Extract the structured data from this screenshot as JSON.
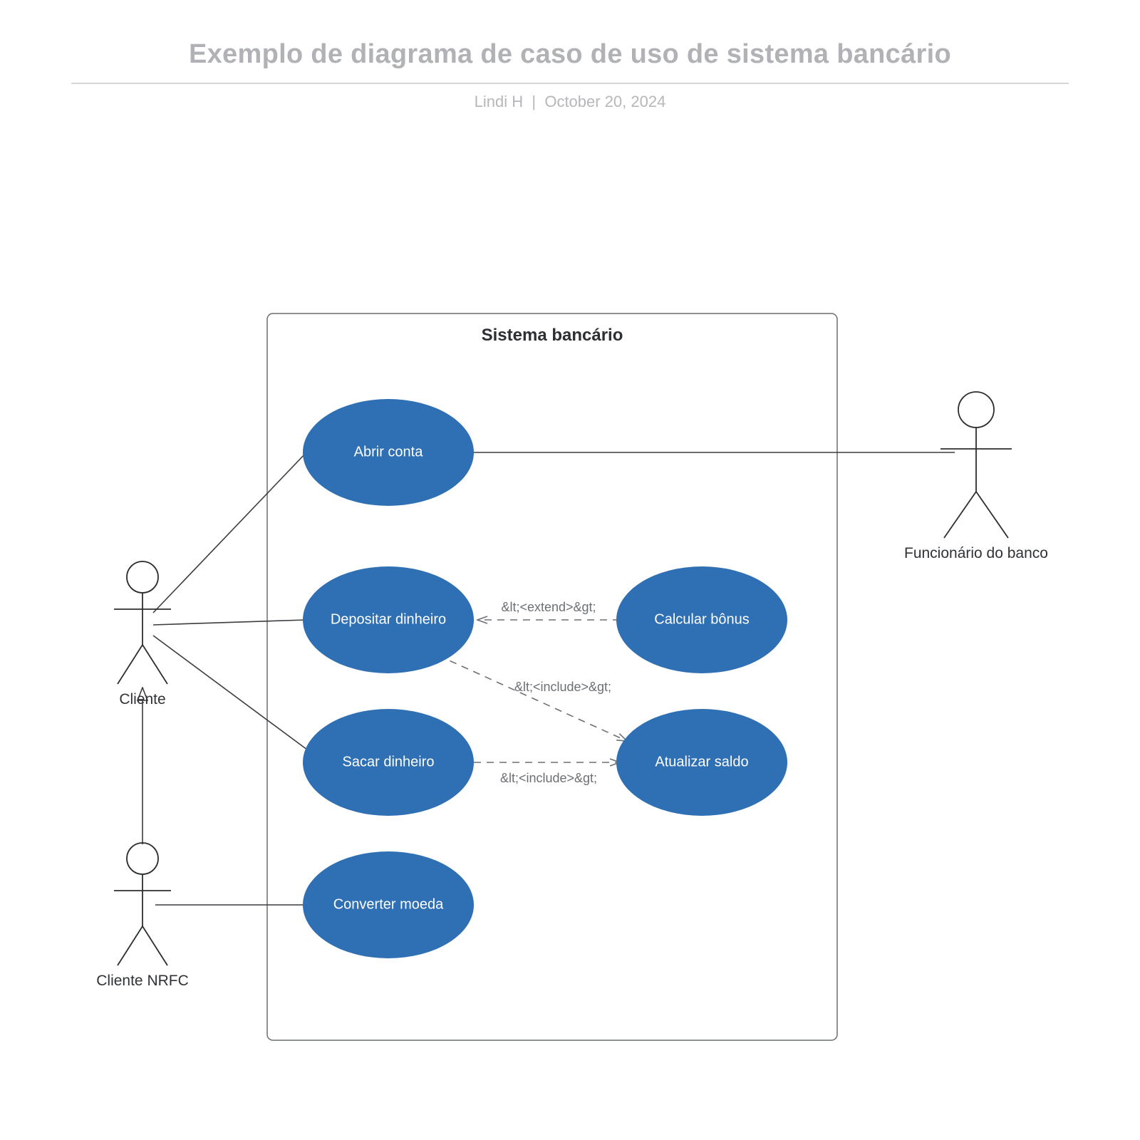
{
  "header": {
    "title": "Exemplo de diagrama de caso de uso de sistema bancário",
    "author": "Lindi H",
    "date": "October 20, 2024",
    "separator": "|"
  },
  "diagram": {
    "system_name": "Sistema bancário",
    "actors": {
      "cliente": "Cliente",
      "cliente_nrfc": "Cliente NRFC",
      "funcionario": "Funcionário do banco"
    },
    "usecases": {
      "abrir_conta": "Abrir conta",
      "depositar": "Depositar dinheiro",
      "sacar": "Sacar dinheiro",
      "converter": "Converter moeda",
      "calcular_bonus": "Calcular bônus",
      "atualizar_saldo": "Atualizar saldo"
    },
    "labels": {
      "extend": "&lt;<extend>&gt;",
      "include": "&lt;<include>&gt;"
    }
  }
}
